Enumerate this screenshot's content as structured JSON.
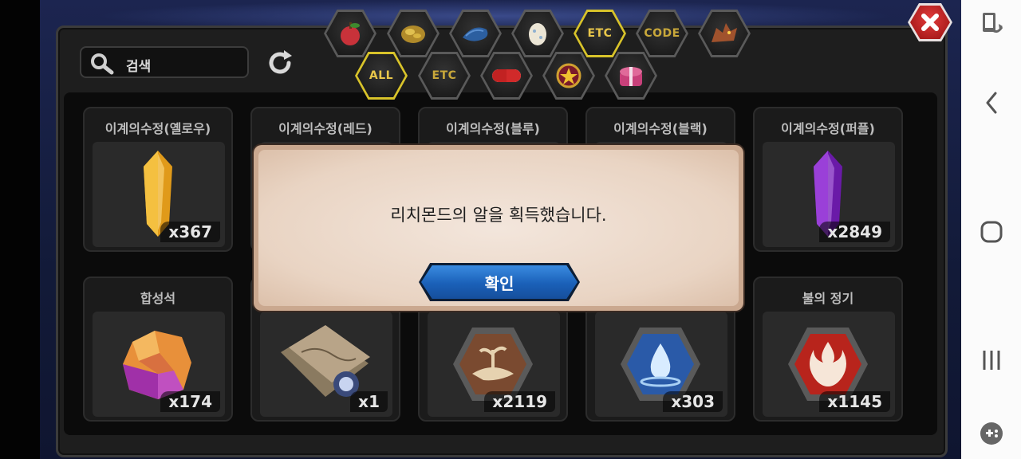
{
  "search": {
    "placeholder": "검색"
  },
  "tabs_top": [
    {
      "icon": "apple-icon"
    },
    {
      "icon": "gold-ore-icon"
    },
    {
      "icon": "blue-fish-icon"
    },
    {
      "icon": "egg-icon"
    },
    {
      "label": "ETC",
      "selected": true
    },
    {
      "label": "CODE",
      "selected": false
    },
    {
      "icon": "dragon-icon"
    }
  ],
  "tabs_sub": [
    {
      "label": "ALL",
      "selected": true
    },
    {
      "label": "ETC",
      "selected": false
    },
    {
      "icon": "capsule-icon"
    },
    {
      "icon": "star-emblem-icon"
    },
    {
      "icon": "gift-box-icon"
    }
  ],
  "items": [
    {
      "name": "이계의수정(옐로우)",
      "count": "x367",
      "icon": "yellow-crystal-icon"
    },
    {
      "name": "이계의수정(레드)",
      "count": "",
      "icon": ""
    },
    {
      "name": "이계의수정(블루)",
      "count": "",
      "icon": ""
    },
    {
      "name": "이계의수정(블랙)",
      "count": "",
      "icon": ""
    },
    {
      "name": "이계의수정(퍼플)",
      "count": "x2849",
      "icon": "purple-crystal-icon"
    },
    {
      "name": "합성석",
      "count": "x174",
      "icon": "synthesis-stone-icon"
    },
    {
      "name": "",
      "count": "x1",
      "icon": "map-scroll-icon"
    },
    {
      "name": "",
      "count": "x2119",
      "icon": "earth-essence-icon"
    },
    {
      "name": "",
      "count": "x303",
      "icon": "water-essence-icon"
    },
    {
      "name": "불의 정기",
      "count": "x1145",
      "icon": "fire-essence-icon"
    }
  ],
  "dialog": {
    "message": "리치몬드의 알을 획득했습니다.",
    "confirm_label": "확인"
  },
  "colors": {
    "accent_gold": "#d8c32a",
    "confirm_blue": "#1a60b8",
    "close_red": "#c82020"
  }
}
